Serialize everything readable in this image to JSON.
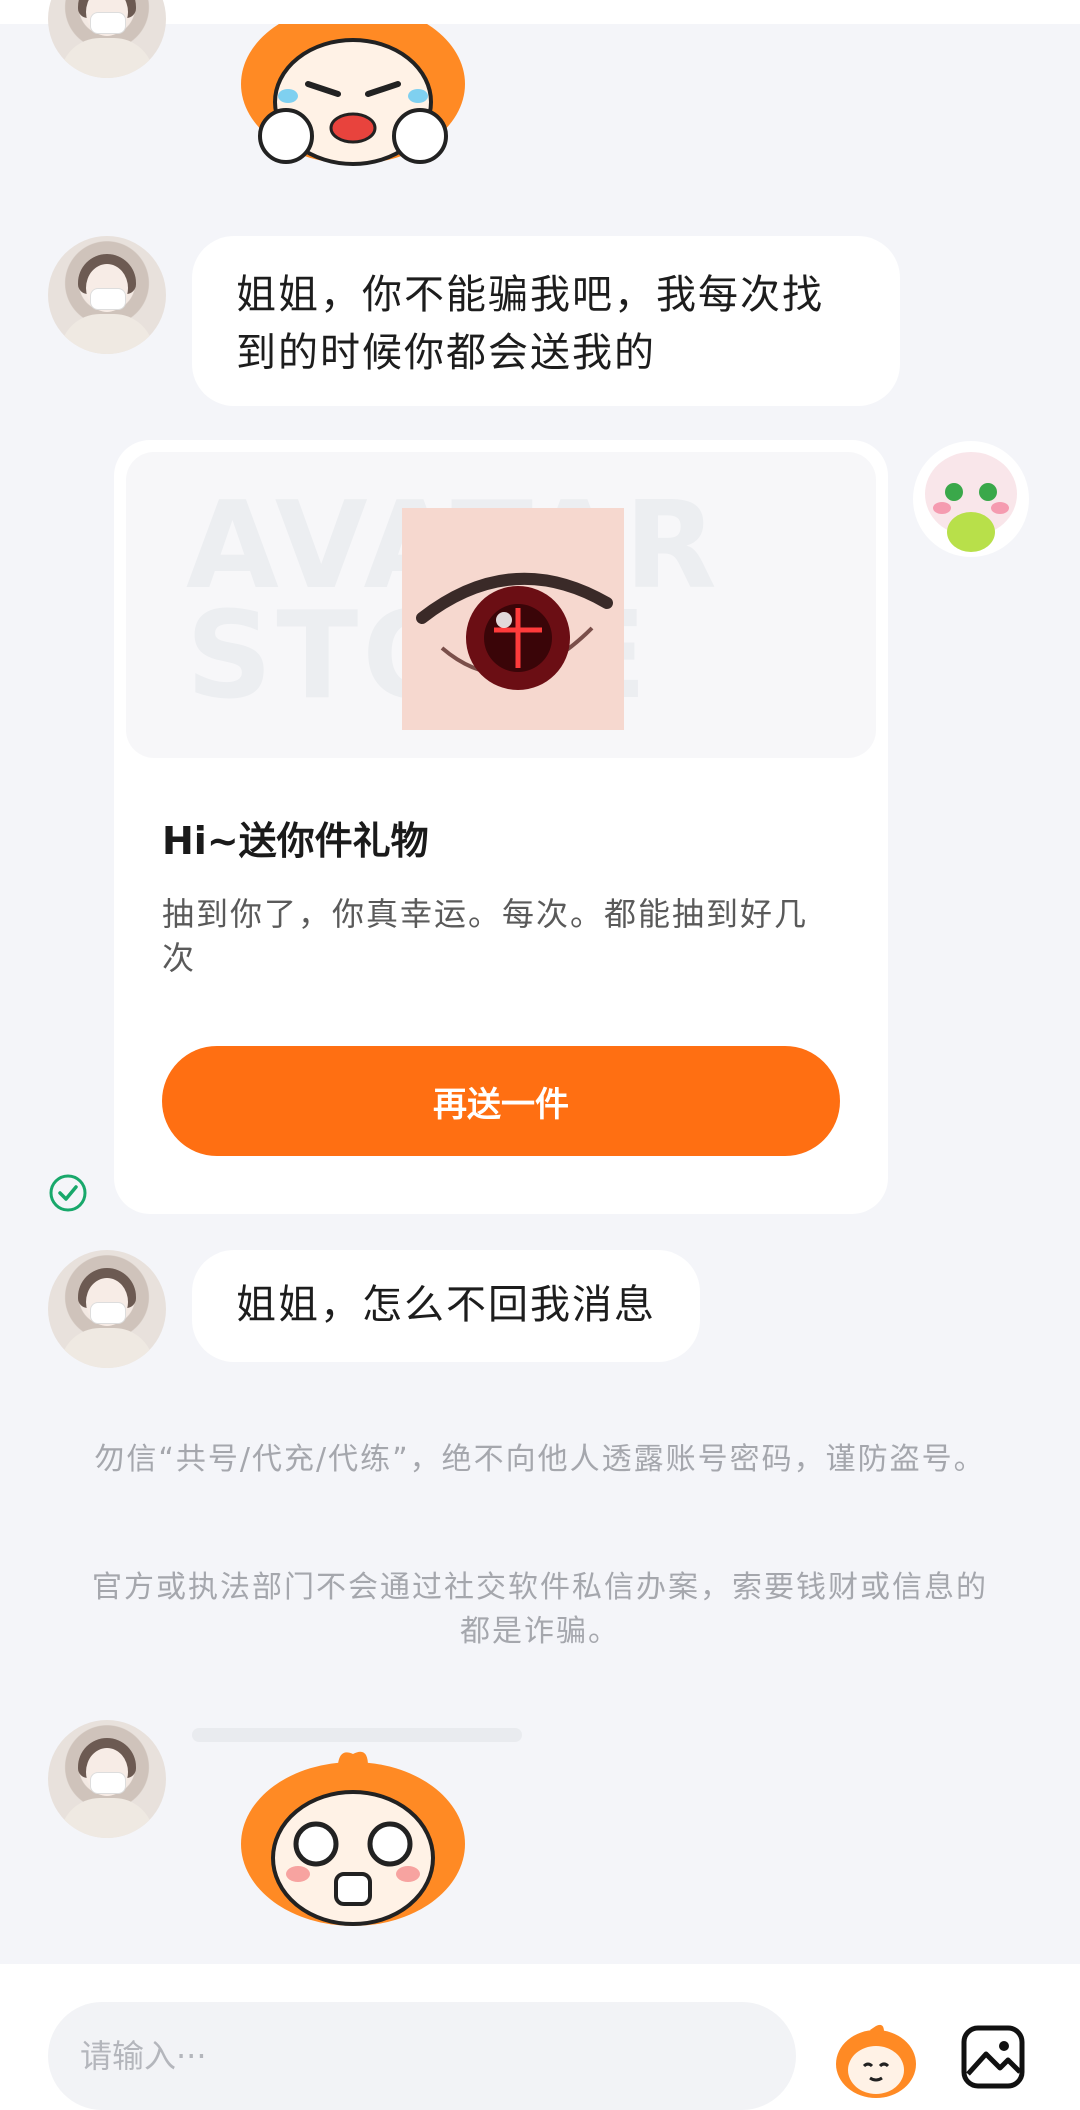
{
  "messages": {
    "m1": {
      "text": "姐姐，你不能骗我吧，我每次找到的时候你都会送我的"
    },
    "m2": {
      "text": "姐姐，怎么不回我消息"
    }
  },
  "gift_card": {
    "watermark": "AVATAR STORE",
    "title": "Hi~送你件礼物",
    "description": "抽到你了，你真幸运。每次。都能抽到好几次",
    "button_label": "再送一件"
  },
  "notice": {
    "line1": "勿信“共号/代充/代练”，绝不向他人透露账号密码，谨防盗号。",
    "line2": "官方或执法部门不会通过社交软件私信办案，索要钱财或信息的都是诈骗。"
  },
  "composer": {
    "placeholder": "请输入···"
  },
  "icons": {
    "sent_status": "check-circle-icon",
    "sticker_button": "mascot-sticker-icon",
    "image_button": "image-icon"
  },
  "colors": {
    "accent": "#ff6f12",
    "background": "#f4f5f9",
    "status": "#18a86b"
  }
}
